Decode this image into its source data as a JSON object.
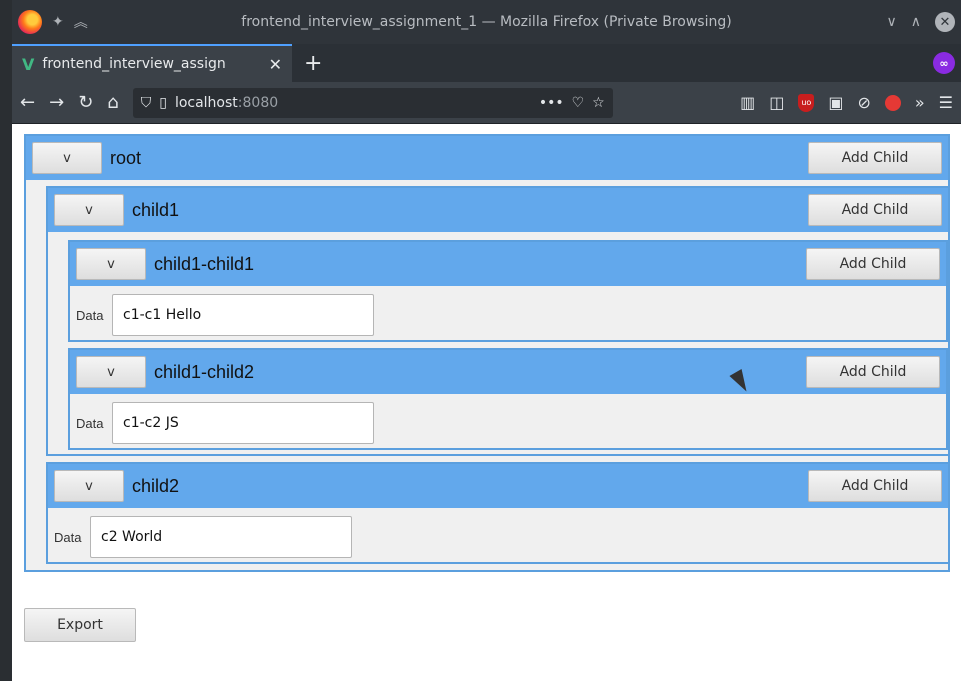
{
  "window": {
    "title": "frontend_interview_assignment_1 — Mozilla Firefox (Private Browsing)"
  },
  "tab": {
    "label": "frontend_interview_assign",
    "close": "✕",
    "new_tab": "+"
  },
  "navbar": {
    "back": "←",
    "forward": "→",
    "reload": "↻",
    "home": "⌂",
    "url_host": "localhost",
    "url_port": ":8080",
    "more": "•••"
  },
  "tree": {
    "toggle_label": "v",
    "add_child_label": "Add Child",
    "data_label": "Data",
    "root": {
      "name": "root"
    },
    "child1": {
      "name": "child1"
    },
    "child1_child1": {
      "name": "child1-child1",
      "data": "c1-c1 Hello"
    },
    "child1_child2": {
      "name": "child1-child2",
      "data": "c1-c2 JS"
    },
    "child2": {
      "name": "child2",
      "data": "c2 World"
    }
  },
  "export_label": "Export",
  "icons": {
    "firefox": "firefox-icon",
    "pin": "pin-icon",
    "private": "private-browsing-icon",
    "shield": "shield-icon",
    "page": "page-icon",
    "pocket": "pocket-icon",
    "bookmark": "star-icon",
    "library": "library-icon",
    "sidebar": "sidebar-icon",
    "ublock": "ublock-icon"
  },
  "colors": {
    "header_blue": "#62a8ec",
    "border_blue": "#5b9fde",
    "panel_gray": "#f0f0f0"
  }
}
